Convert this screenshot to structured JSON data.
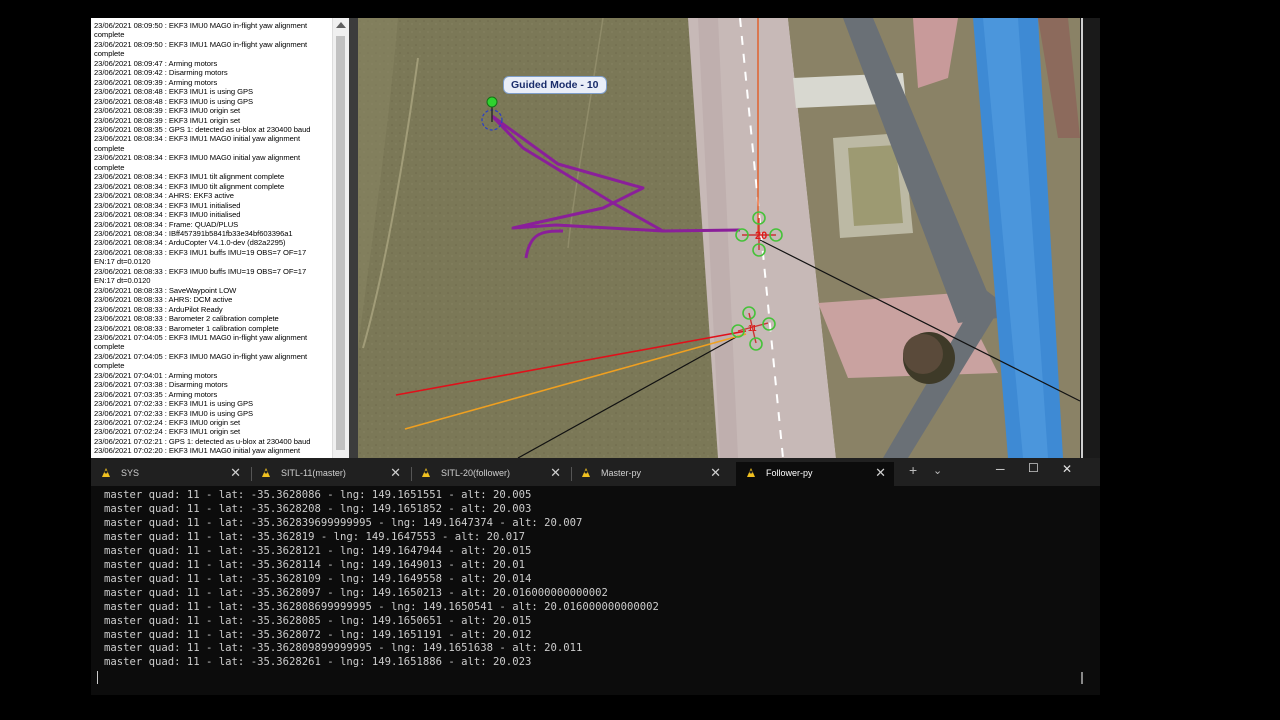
{
  "messages": [
    "23/06/2021 08:09:50 : EKF3 IMU0 MAG0 in-flight yaw alignment",
    "complete",
    "23/06/2021 08:09:50 : EKF3 IMU1 MAG0 in-flight yaw alignment",
    "complete",
    "23/06/2021 08:09:47 : Arming motors",
    "23/06/2021 08:09:42 : Disarming motors",
    "23/06/2021 08:09:39 : Arming motors",
    "23/06/2021 08:08:48 : EKF3 IMU1 is using GPS",
    "23/06/2021 08:08:48 : EKF3 IMU0 is using GPS",
    "23/06/2021 08:08:39 : EKF3 IMU0 origin set",
    "23/06/2021 08:08:39 : EKF3 IMU1 origin set",
    "23/06/2021 08:08:35 : GPS 1: detected as u-blox at 230400 baud",
    "23/06/2021 08:08:34 : EKF3 IMU1 MAG0 initial yaw alignment",
    "complete",
    "23/06/2021 08:08:34 : EKF3 IMU0 MAG0 initial yaw alignment",
    "complete",
    "23/06/2021 08:08:34 : EKF3 IMU1 tilt alignment complete",
    "23/06/2021 08:08:34 : EKF3 IMU0 tilt alignment complete",
    "23/06/2021 08:08:34 : AHRS: EKF3 active",
    "23/06/2021 08:08:34 : EKF3 IMU1 initialised",
    "23/06/2021 08:08:34 : EKF3 IMU0 initialised",
    "23/06/2021 08:08:34 : Frame: QUAD/PLUS",
    "23/06/2021 08:08:34 : IBff457391b5841fb33e34bf603396a1",
    "23/06/2021 08:08:34 : ArduCopter V4.1.0-dev (d82a2295)",
    "23/06/2021 08:08:33 : EKF3 IMU1 buffs IMU=19 OBS=7 OF=17",
    "EN:17 dt=0.0120",
    "23/06/2021 08:08:33 : EKF3 IMU0 buffs IMU=19 OBS=7 OF=17",
    "EN:17 dt=0.0120",
    "23/06/2021 08:08:33 : SaveWaypoint LOW",
    "23/06/2021 08:08:33 : AHRS: DCM active",
    "23/06/2021 08:08:33 : ArduPilot Ready",
    "23/06/2021 08:08:33 : Barometer 2 calibration complete",
    "23/06/2021 08:08:33 : Barometer 1 calibration complete",
    "23/06/2021 07:04:05 : EKF3 IMU1 MAG0 in-flight yaw alignment",
    "complete",
    "23/06/2021 07:04:05 : EKF3 IMU0 MAG0 in-flight yaw alignment",
    "complete",
    "23/06/2021 07:04:01 : Arming motors",
    "23/06/2021 07:03:38 : Disarming motors",
    "23/06/2021 07:03:35 : Arming motors",
    "23/06/2021 07:02:33 : EKF3 IMU1 is using GPS",
    "23/06/2021 07:02:33 : EKF3 IMU0 is using GPS",
    "23/06/2021 07:02:24 : EKF3 IMU0 origin set",
    "23/06/2021 07:02:24 : EKF3 IMU1 origin set",
    "23/06/2021 07:02:21 : GPS 1: detected as u-blox at 230400 baud",
    "23/06/2021 07:02:20 : EKF3 IMU1 MAG0 initial yaw alignment"
  ],
  "map": {
    "guided_label": "Guided Mode - 10",
    "follower_number": "20",
    "master_number": "11"
  },
  "tabs": [
    {
      "label": "SYS",
      "icon": "linux-penguin-icon"
    },
    {
      "label": "SITL-11(master)",
      "icon": "linux-penguin-icon"
    },
    {
      "label": "SITL-20(follower)",
      "icon": "linux-penguin-icon"
    },
    {
      "label": "Master-py",
      "icon": "linux-penguin-icon"
    },
    {
      "label": "Follower-py",
      "icon": "linux-penguin-icon"
    }
  ],
  "terminal_lines": [
    "master quad: 11 - lat: -35.3628086 - lng: 149.1651551 - alt: 20.005",
    "master quad: 11 - lat: -35.3628208 - lng: 149.1651852 - alt: 20.003",
    "master quad: 11 - lat: -35.362839699999995 - lng: 149.1647374 - alt: 20.007",
    "master quad: 11 - lat: -35.362819 - lng: 149.1647553 - alt: 20.017",
    "master quad: 11 - lat: -35.3628121 - lng: 149.1647944 - alt: 20.015",
    "master quad: 11 - lat: -35.3628114 - lng: 149.1649013 - alt: 20.01",
    "master quad: 11 - lat: -35.3628109 - lng: 149.1649558 - alt: 20.014",
    "master quad: 11 - lat: -35.3628097 - lng: 149.1650213 - alt: 20.016000000000002",
    "master quad: 11 - lat: -35.362808699999995 - lng: 149.1650541 - alt: 20.016000000000002",
    "master quad: 11 - lat: -35.3628085 - lng: 149.1650651 - alt: 20.015",
    "master quad: 11 - lat: -35.3628072 - lng: 149.1651191 - alt: 20.012",
    "master quad: 11 - lat: -35.362809899999995 - lng: 149.1651638 - alt: 20.011",
    "master quad: 11 - lat: -35.3628261 - lng: 149.1651886 - alt: 20.023"
  ],
  "colors": {
    "track": "#8a1f9a",
    "master_heading": "#d93a10",
    "red_line": "#e0101a",
    "orange_line": "#f0a020",
    "waypoint": "#2fd32f"
  }
}
